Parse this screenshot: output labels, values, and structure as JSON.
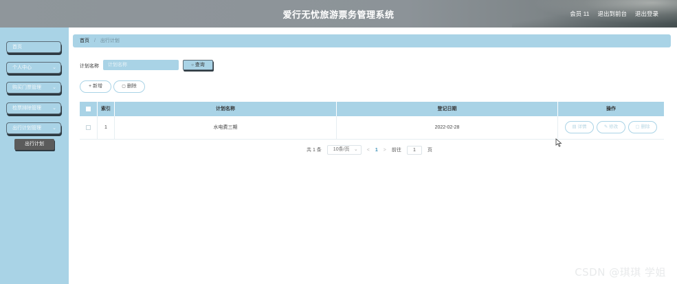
{
  "header": {
    "title": "爱行无忧旅游票务管理系统",
    "user_label": "会员 11",
    "exit_to_front": "退出到前台",
    "logout": "退出登录"
  },
  "sidebar": {
    "items": [
      {
        "label": "首页",
        "has_chevron": false
      },
      {
        "label": "个人中心",
        "has_chevron": true
      },
      {
        "label": "购买门票管理",
        "has_chevron": true
      },
      {
        "label": "检票排除管理",
        "has_chevron": true
      },
      {
        "label": "出行计划管理",
        "has_chevron": true
      }
    ],
    "sub_item": "出行计划",
    "chevron": "⌄"
  },
  "breadcrumb": {
    "home": "首页",
    "separator": "/",
    "current": "出行计划"
  },
  "search": {
    "label": "计划名称",
    "placeholder": "计划名称",
    "button_label": "查询",
    "button_icon": "🔍"
  },
  "actions": {
    "add_label": "新增",
    "add_icon": "+",
    "delete_label": "删除",
    "delete_icon": "🗑"
  },
  "table": {
    "headers": {
      "index": "索引",
      "plan_name": "计划名称",
      "date": "登记日期",
      "ops": "操作"
    },
    "rows": [
      {
        "index": "1",
        "plan_name": "水电费三期",
        "date": "2022-02-28"
      }
    ],
    "op_buttons": {
      "detail": "详情",
      "edit": "修改",
      "delete": "删除"
    }
  },
  "pagination": {
    "total": "共 1 条",
    "page_size": "10条/页",
    "prev": "<",
    "current": "1",
    "next": ">",
    "goto_label": "前往",
    "goto_value": "1",
    "page_suffix": "页"
  },
  "watermark": "CSDN @琪琪 学姐",
  "colors": {
    "accent": "#a9d3e6",
    "header": "#8f969b",
    "sub_item": "#5b5b5b"
  }
}
